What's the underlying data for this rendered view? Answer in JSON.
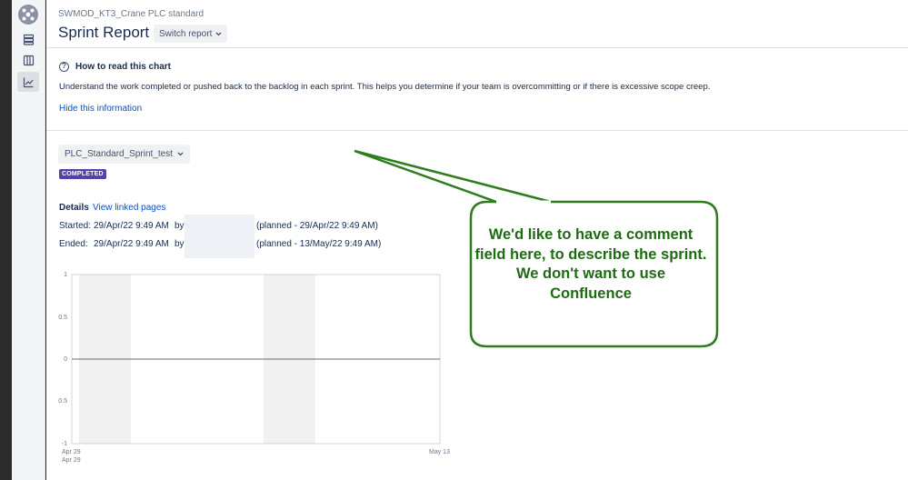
{
  "breadcrumb": "SWMOD_KT3_Crane PLC standard",
  "title": "Sprint Report",
  "switch_report": "Switch report",
  "help": {
    "heading": "How to read this chart",
    "body": "Understand the work completed or pushed back to the backlog in each sprint. This helps you determine if your team is overcommitting or if there is excessive scope creep.",
    "hide": "Hide this information"
  },
  "sprint": {
    "name": "PLC_Standard_Sprint_test",
    "status": "COMPLETED"
  },
  "details": {
    "label": "Details",
    "view_linked": "View linked pages",
    "started_label": "Started:",
    "started_value": "29/Apr/22 9:49 AM",
    "started_by": "by",
    "started_planned": "(planned - 29/Apr/22 9:49 AM)",
    "ended_label": "Ended:",
    "ended_value": "29/Apr/22 9:49 AM",
    "ended_by": "by",
    "ended_planned": "(planned - 13/May/22 9:49 AM)"
  },
  "chart_data": {
    "type": "line",
    "y_ticks": [
      "1",
      "0.5",
      "0",
      "0.5",
      "-1"
    ],
    "ylim": [
      -1,
      1
    ],
    "x_ticks": [
      {
        "line1": "Apr 29",
        "line2": "Apr 29"
      },
      {
        "line1": "May 13",
        "line2": ""
      }
    ],
    "series": [
      {
        "values": [
          0,
          0
        ]
      }
    ],
    "weekend_bands": true
  },
  "callout": {
    "text": "We'd like to have a comment field here, to describe the sprint. We don't want to use Confluence",
    "color": "#1e6b13"
  },
  "colors": {
    "accent": "#0052cc",
    "lozenge": "#5243aa"
  }
}
